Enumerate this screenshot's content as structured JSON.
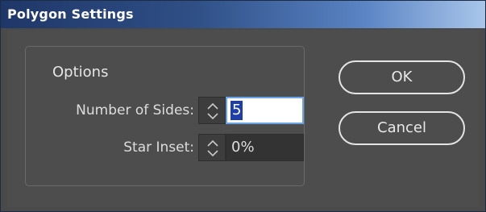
{
  "dialog": {
    "title": "Polygon Settings",
    "options_group": {
      "legend": "Options",
      "number_of_sides": {
        "label": "Number of Sides:",
        "value": "5"
      },
      "star_inset": {
        "label": "Star Inset:",
        "value": "0%"
      }
    },
    "buttons": {
      "ok": "OK",
      "cancel": "Cancel"
    }
  },
  "colors": {
    "background": "#4d4d4d",
    "selection": "#1e3fa8",
    "focus_ring": "#6aa4e8"
  },
  "icons": {
    "spinner": "up-down-arrows-icon"
  }
}
